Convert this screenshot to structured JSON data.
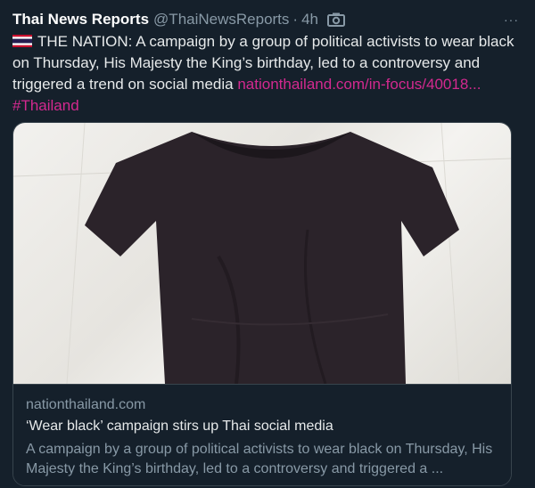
{
  "tweet": {
    "author_name": "Thai News Reports",
    "handle": "@ThaiNewsReports",
    "separator": "·",
    "time": "4h",
    "header_icon": "camera-icon",
    "more_icon": "more-dots-icon",
    "more_label": "···",
    "flag_icon": "thailand-flag-icon",
    "text": "THE NATION: A campaign by a group of political activists to wear black on Thursday, His Majesty the King’s birthday, led to a controversy and triggered a trend on social media",
    "link_text": "nationthailand.com/in-focus/40018...",
    "hashtag": "#Thailand",
    "colors": {
      "background": "#15202b",
      "link": "#d3298f",
      "muted": "#8899a6",
      "border": "#38444d"
    }
  },
  "card": {
    "image_icon": "black-tshirt-image",
    "domain": "nationthailand.com",
    "title": "‘Wear black’ campaign stirs up Thai social media",
    "description": "A campaign by a group of political activists to wear black on Thursday, His Majesty the King’s birthday, led to a controversy and triggered a ..."
  }
}
